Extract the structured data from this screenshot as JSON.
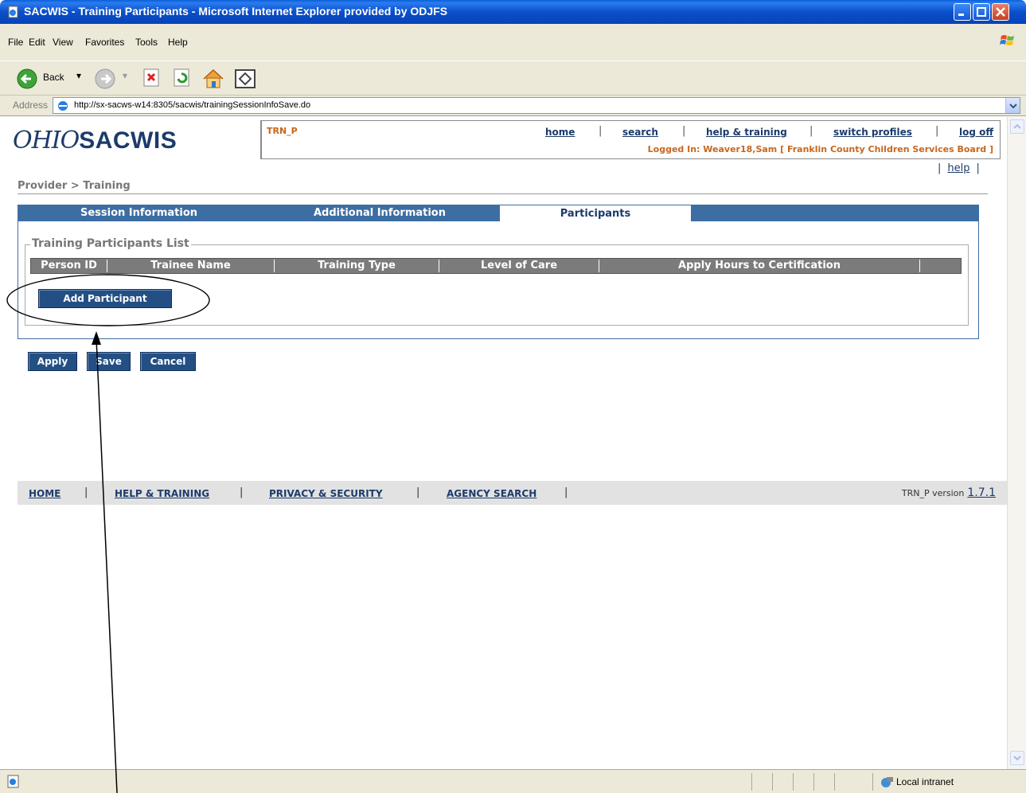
{
  "window": {
    "title": "SACWIS - Training Participants - Microsoft Internet Explorer provided by ODJFS"
  },
  "menu": [
    "File",
    "Edit",
    "View",
    "Favorites",
    "Tools",
    "Help"
  ],
  "toolbar": {
    "back_label": "Back"
  },
  "address": {
    "label": "Address",
    "url": "http://sx-sacws-w14:8305/sacwis/trainingSessionInfoSave.do"
  },
  "header": {
    "logo_ohio": "OHIO",
    "logo_sacwis": "SACWIS",
    "screen_code": "TRN_P",
    "nav": [
      "home",
      "search",
      "help & training",
      "switch profiles",
      "log off"
    ],
    "logged_in": "Logged In:  Weaver18,Sam [ Franklin County Children Services Board ]",
    "help": "help"
  },
  "breadcrumb": "Provider > Training",
  "tabs": [
    "Session Information",
    "Additional Information",
    "Participants"
  ],
  "participants": {
    "legend": "Training Participants List",
    "columns": [
      "Person ID",
      "Trainee Name",
      "Training Type",
      "Level of Care",
      "Apply Hours to Certification"
    ],
    "add_button": "Add Participant"
  },
  "actions": {
    "apply": "Apply",
    "save": "Save",
    "cancel": "Cancel"
  },
  "footer": {
    "links": [
      "HOME",
      "HELP & TRAINING",
      "PRIVACY & SECURITY",
      "AGENCY SEARCH"
    ],
    "version_prefix": "TRN_P version",
    "version": "1.7.1"
  },
  "status": {
    "zone": "Local intranet"
  },
  "colors": {
    "brand_blue": "#1c3b6b",
    "tab_blue": "#3d6ea3",
    "button_blue": "#244f84",
    "accent_orange": "#c8661c"
  }
}
